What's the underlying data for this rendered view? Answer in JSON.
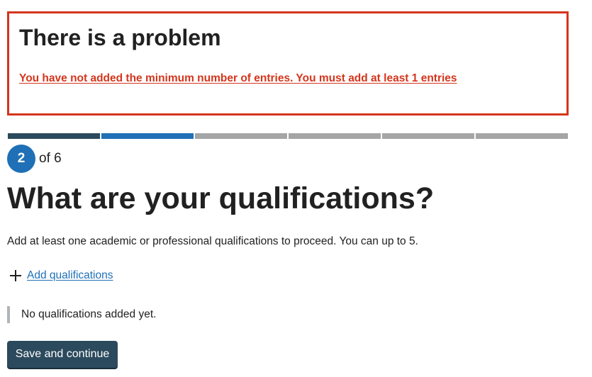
{
  "error_summary": {
    "title": "There is a problem",
    "message": "You have not added the minimum number of entries. You must add at least 1 entries",
    "color": "#d4351c"
  },
  "progress": {
    "current_step": "2",
    "of_text": "of 6",
    "total_steps": 6,
    "completed_steps": 1,
    "colors": {
      "done": "#2c4a5d",
      "current": "#1f70b6",
      "pending": "#a5a5a5"
    }
  },
  "main": {
    "title": "What are your qualifications?",
    "hint": "Add at least one academic or professional qualifications to proceed. You can up to 5.",
    "add_link": {
      "label": "Add qualifications",
      "icon": "plus-icon"
    },
    "empty_state": "No qualifications added yet.",
    "submit_label": "Save and continue"
  }
}
